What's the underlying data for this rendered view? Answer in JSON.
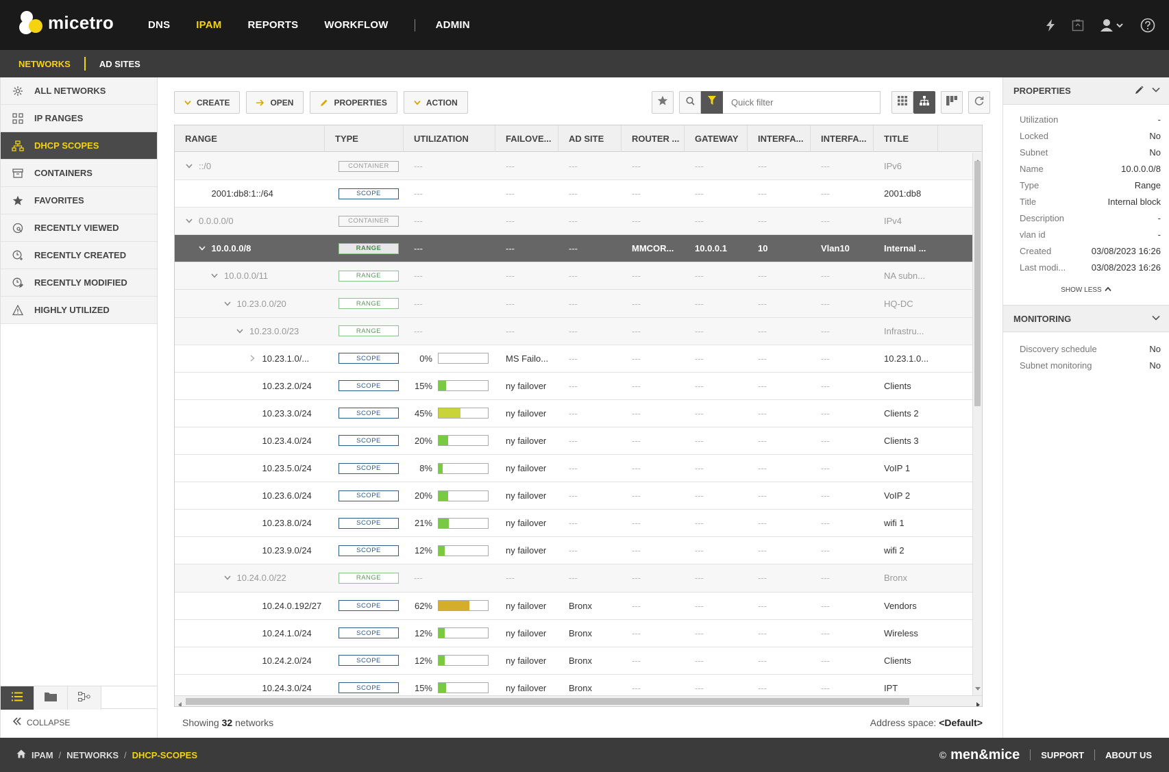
{
  "app": {
    "name": "micetro"
  },
  "nav": {
    "items": [
      "DNS",
      "IPAM",
      "REPORTS",
      "WORKFLOW",
      "ADMIN"
    ],
    "active": "IPAM"
  },
  "subnav": {
    "items": [
      "NETWORKS",
      "AD SITES"
    ],
    "active": "NETWORKS"
  },
  "sidebar": {
    "items": [
      {
        "label": "ALL NETWORKS",
        "icon": "network-icon"
      },
      {
        "label": "IP RANGES",
        "icon": "ip-ranges-icon"
      },
      {
        "label": "DHCP SCOPES",
        "icon": "dhcp-scopes-icon"
      },
      {
        "label": "CONTAINERS",
        "icon": "container-icon"
      },
      {
        "label": "FAVORITES",
        "icon": "star-icon"
      },
      {
        "label": "RECENTLY VIEWED",
        "icon": "recently-viewed-icon"
      },
      {
        "label": "RECENTLY CREATED",
        "icon": "recently-created-icon"
      },
      {
        "label": "RECENTLY MODIFIED",
        "icon": "recently-modified-icon"
      },
      {
        "label": "HIGHLY UTILIZED",
        "icon": "warning-icon"
      }
    ],
    "active": "DHCP SCOPES",
    "collapse_label": "COLLAPSE"
  },
  "toolbar": {
    "create": "CREATE",
    "open": "OPEN",
    "properties": "PROPERTIES",
    "action": "ACTION",
    "quick_filter_placeholder": "Quick filter"
  },
  "grid": {
    "columns": [
      "RANGE",
      "TYPE",
      "UTILIZATION",
      "FAILOVE...",
      "AD SITE",
      "ROUTER ...",
      "GATEWAY",
      "INTERFA...",
      "INTERFA...",
      "TITLE"
    ],
    "rows": [
      {
        "range": "::/0",
        "indent": 0,
        "chev": "down",
        "type": "CONTAINER",
        "util": null,
        "failover": "---",
        "adsite": "---",
        "router": "---",
        "gateway": "---",
        "if1": "---",
        "if2": "---",
        "title": "IPv6",
        "style": "grey"
      },
      {
        "range": "2001:db8:1::/64",
        "indent": 1,
        "chev": "",
        "type": "SCOPE",
        "util": null,
        "failover": "---",
        "adsite": "---",
        "router": "---",
        "gateway": "---",
        "if1": "---",
        "if2": "---",
        "title": "2001:db8",
        "style": ""
      },
      {
        "range": "0.0.0.0/0",
        "indent": 0,
        "chev": "down",
        "type": "CONTAINER",
        "util": null,
        "failover": "---",
        "adsite": "---",
        "router": "---",
        "gateway": "---",
        "if1": "---",
        "if2": "---",
        "title": "IPv4",
        "style": "grey"
      },
      {
        "range": "10.0.0.0/8",
        "indent": 1,
        "chev": "down",
        "type": "RANGE",
        "util": null,
        "failover": "---",
        "adsite": "---",
        "router": "MMCOR...",
        "gateway": "10.0.0.1",
        "if1": "10",
        "if2": "Vlan10",
        "title": "Internal ...",
        "style": "sel"
      },
      {
        "range": "10.0.0.0/11",
        "indent": 2,
        "chev": "down",
        "type": "RANGE",
        "util": null,
        "failover": "---",
        "adsite": "---",
        "router": "---",
        "gateway": "---",
        "if1": "---",
        "if2": "---",
        "title": "NA subn...",
        "style": "grey"
      },
      {
        "range": "10.23.0.0/20",
        "indent": 3,
        "chev": "down",
        "type": "RANGE",
        "util": null,
        "failover": "---",
        "adsite": "---",
        "router": "---",
        "gateway": "---",
        "if1": "---",
        "if2": "---",
        "title": "HQ-DC",
        "style": "grey"
      },
      {
        "range": "10.23.0.0/23",
        "indent": 4,
        "chev": "down",
        "type": "RANGE",
        "util": null,
        "failover": "---",
        "adsite": "---",
        "router": "---",
        "gateway": "---",
        "if1": "---",
        "if2": "---",
        "title": "Infrastru...",
        "style": "grey"
      },
      {
        "range": "10.23.1.0/...",
        "indent": 5,
        "chev": "right",
        "type": "SCOPE",
        "util": 0,
        "pct": "0%",
        "failover": "MS Failo...",
        "adsite": "---",
        "router": "---",
        "gateway": "---",
        "if1": "---",
        "if2": "---",
        "title": "10.23.1.0...",
        "style": ""
      },
      {
        "range": "10.23.2.0/24",
        "indent": 5,
        "chev": "",
        "type": "SCOPE",
        "util": 15,
        "pct": "15%",
        "failover": "ny failover",
        "adsite": "---",
        "router": "---",
        "gateway": "---",
        "if1": "---",
        "if2": "---",
        "title": "Clients",
        "style": ""
      },
      {
        "range": "10.23.3.0/24",
        "indent": 5,
        "chev": "",
        "type": "SCOPE",
        "util": 45,
        "pct": "45%",
        "failover": "ny failover",
        "adsite": "---",
        "router": "---",
        "gateway": "---",
        "if1": "---",
        "if2": "---",
        "title": "Clients 2",
        "style": ""
      },
      {
        "range": "10.23.4.0/24",
        "indent": 5,
        "chev": "",
        "type": "SCOPE",
        "util": 20,
        "pct": "20%",
        "failover": "ny failover",
        "adsite": "---",
        "router": "---",
        "gateway": "---",
        "if1": "---",
        "if2": "---",
        "title": "Clients 3",
        "style": ""
      },
      {
        "range": "10.23.5.0/24",
        "indent": 5,
        "chev": "",
        "type": "SCOPE",
        "util": 8,
        "pct": "8%",
        "failover": "ny failover",
        "adsite": "---",
        "router": "---",
        "gateway": "---",
        "if1": "---",
        "if2": "---",
        "title": "VoIP 1",
        "style": ""
      },
      {
        "range": "10.23.6.0/24",
        "indent": 5,
        "chev": "",
        "type": "SCOPE",
        "util": 20,
        "pct": "20%",
        "failover": "ny failover",
        "adsite": "---",
        "router": "---",
        "gateway": "---",
        "if1": "---",
        "if2": "---",
        "title": "VoIP 2",
        "style": ""
      },
      {
        "range": "10.23.8.0/24",
        "indent": 5,
        "chev": "",
        "type": "SCOPE",
        "util": 21,
        "pct": "21%",
        "failover": "ny failover",
        "adsite": "---",
        "router": "---",
        "gateway": "---",
        "if1": "---",
        "if2": "---",
        "title": "wifi 1",
        "style": ""
      },
      {
        "range": "10.23.9.0/24",
        "indent": 5,
        "chev": "",
        "type": "SCOPE",
        "util": 12,
        "pct": "12%",
        "failover": "ny failover",
        "adsite": "---",
        "router": "---",
        "gateway": "---",
        "if1": "---",
        "if2": "---",
        "title": "wifi 2",
        "style": ""
      },
      {
        "range": "10.24.0.0/22",
        "indent": 3,
        "chev": "down",
        "type": "RANGE",
        "util": null,
        "failover": "---",
        "adsite": "---",
        "router": "---",
        "gateway": "---",
        "if1": "---",
        "if2": "---",
        "title": "Bronx",
        "style": "grey"
      },
      {
        "range": "10.24.0.192/27",
        "indent": 5,
        "chev": "",
        "type": "SCOPE",
        "util": 62,
        "pct": "62%",
        "failover": "ny failover",
        "adsite": "Bronx",
        "router": "---",
        "gateway": "---",
        "if1": "---",
        "if2": "---",
        "title": "Vendors",
        "style": ""
      },
      {
        "range": "10.24.1.0/24",
        "indent": 5,
        "chev": "",
        "type": "SCOPE",
        "util": 12,
        "pct": "12%",
        "failover": "ny failover",
        "adsite": "Bronx",
        "router": "---",
        "gateway": "---",
        "if1": "---",
        "if2": "---",
        "title": "Wireless",
        "style": ""
      },
      {
        "range": "10.24.2.0/24",
        "indent": 5,
        "chev": "",
        "type": "SCOPE",
        "util": 12,
        "pct": "12%",
        "failover": "ny failover",
        "adsite": "Bronx",
        "router": "---",
        "gateway": "---",
        "if1": "---",
        "if2": "---",
        "title": "Clients",
        "style": ""
      },
      {
        "range": "10.24.3.0/24",
        "indent": 5,
        "chev": "",
        "type": "SCOPE",
        "util": 15,
        "pct": "15%",
        "failover": "ny failover",
        "adsite": "Bronx",
        "router": "---",
        "gateway": "---",
        "if1": "---",
        "if2": "---",
        "title": "IPT",
        "style": ""
      }
    ]
  },
  "status": {
    "showing_prefix": "Showing",
    "count": "32",
    "showing_suffix": "networks",
    "address_label": "Address space:",
    "address_value": "<Default>"
  },
  "properties": {
    "title": "PROPERTIES",
    "rows": [
      {
        "k": "Utilization",
        "v": "-"
      },
      {
        "k": "Locked",
        "v": "No"
      },
      {
        "k": "Subnet",
        "v": "No"
      },
      {
        "k": "Name",
        "v": "10.0.0.0/8"
      },
      {
        "k": "Type",
        "v": "Range"
      },
      {
        "k": "Title",
        "v": "Internal block"
      },
      {
        "k": "Description",
        "v": "-"
      },
      {
        "k": "vlan id",
        "v": "-"
      },
      {
        "k": "Created",
        "v": "03/08/2023 16:26"
      },
      {
        "k": "Last modi...",
        "v": "03/08/2023 16:26"
      }
    ],
    "show_less": "SHOW LESS"
  },
  "monitoring": {
    "title": "MONITORING",
    "rows": [
      {
        "k": "Discovery schedule",
        "v": "No"
      },
      {
        "k": "Subnet monitoring",
        "v": "No"
      }
    ]
  },
  "breadcrumb": [
    "IPAM",
    "NETWORKS",
    "DHCP-SCOPES"
  ],
  "footer": {
    "brand": "men&mice",
    "copyright": "©",
    "support": "SUPPORT",
    "about": "ABOUT US"
  },
  "colors": {
    "accent": "#f5d30f",
    "bar_green": "#7ac943",
    "bar_yellow": "#c8d43a",
    "bar_gold": "#d4ad2a",
    "selected_row": "#666666"
  }
}
